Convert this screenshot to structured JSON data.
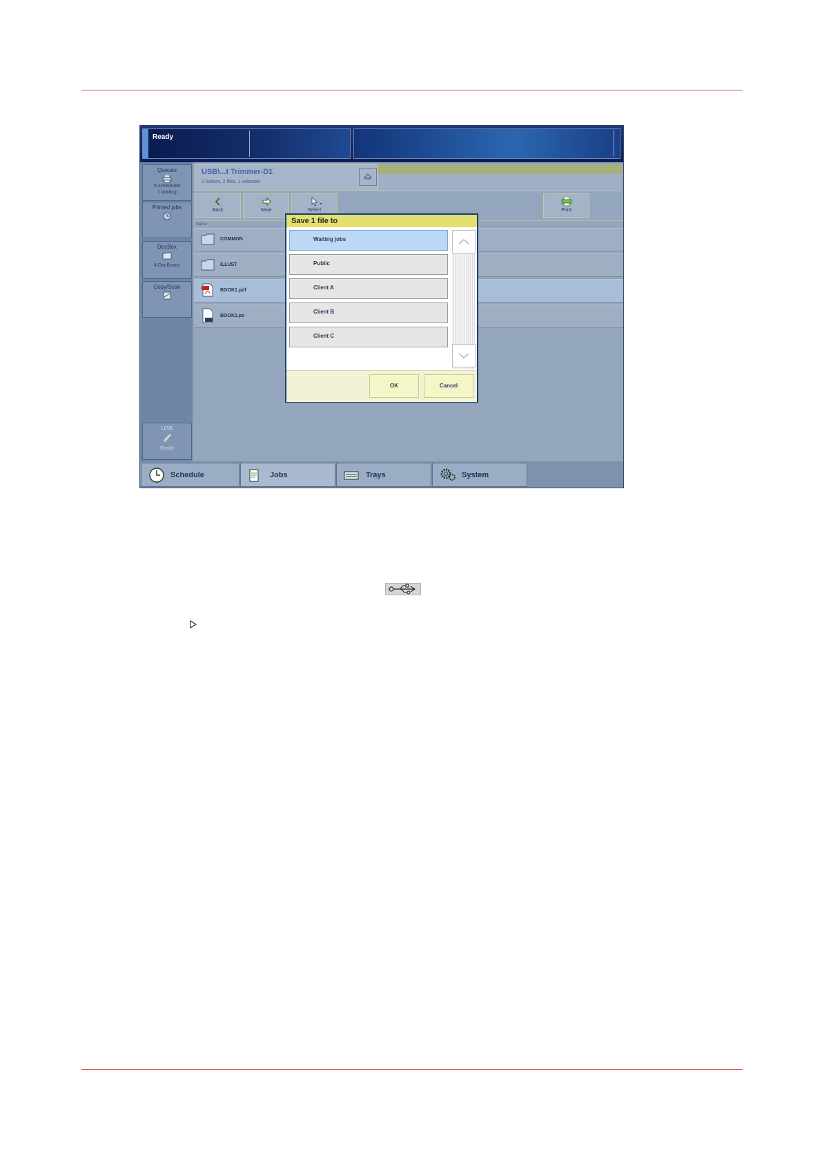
{
  "status": {
    "text": "Ready"
  },
  "leftnav": {
    "queues": {
      "title": "Queues",
      "line1": "6 scheduled",
      "line2": "1 waiting"
    },
    "printed_jobs": {
      "title": "Printed jobs"
    },
    "docbox": {
      "title": "DocBox",
      "sub": "4 DocBoxes"
    },
    "copy_scan": {
      "title": "Copy/Scan"
    },
    "usb": {
      "title": "USB",
      "sub": "Ready"
    }
  },
  "location": {
    "title": "USB\\...t Trimmer-D1",
    "subtitle": "2 folders, 2 files, 1 selected"
  },
  "toolbar": {
    "back": "Back",
    "save": "Save",
    "select": "Select",
    "print": "Print"
  },
  "file_list": {
    "header": "Name",
    "rows": [
      {
        "name": "COMMON",
        "type": "folder"
      },
      {
        "name": "ILLUST",
        "type": "folder"
      },
      {
        "name": "BOOK1.pdf",
        "type": "pdf",
        "selected": true
      },
      {
        "name": "BOOK1.ps",
        "type": "ps"
      }
    ]
  },
  "dialog": {
    "title": "Save 1 file to",
    "options": [
      {
        "label": "Waiting jobs",
        "selected": true
      },
      {
        "label": "Public"
      },
      {
        "label": "Client A"
      },
      {
        "label": "Client B"
      },
      {
        "label": "Client C"
      }
    ],
    "ok": "OK",
    "cancel": "Cancel"
  },
  "bottom_tabs": [
    {
      "label": "Schedule",
      "icon": "clock-icon"
    },
    {
      "label": "Jobs",
      "icon": "jobs-icon",
      "active": true
    },
    {
      "label": "Trays",
      "icon": "trays-icon"
    },
    {
      "label": "System",
      "icon": "gear-icon"
    }
  ],
  "colors": {
    "rule": "#d9534f",
    "dialog_title": "#e3e06d",
    "selected_option": "#bcd8f5",
    "status_bar": "#0c1e55"
  }
}
